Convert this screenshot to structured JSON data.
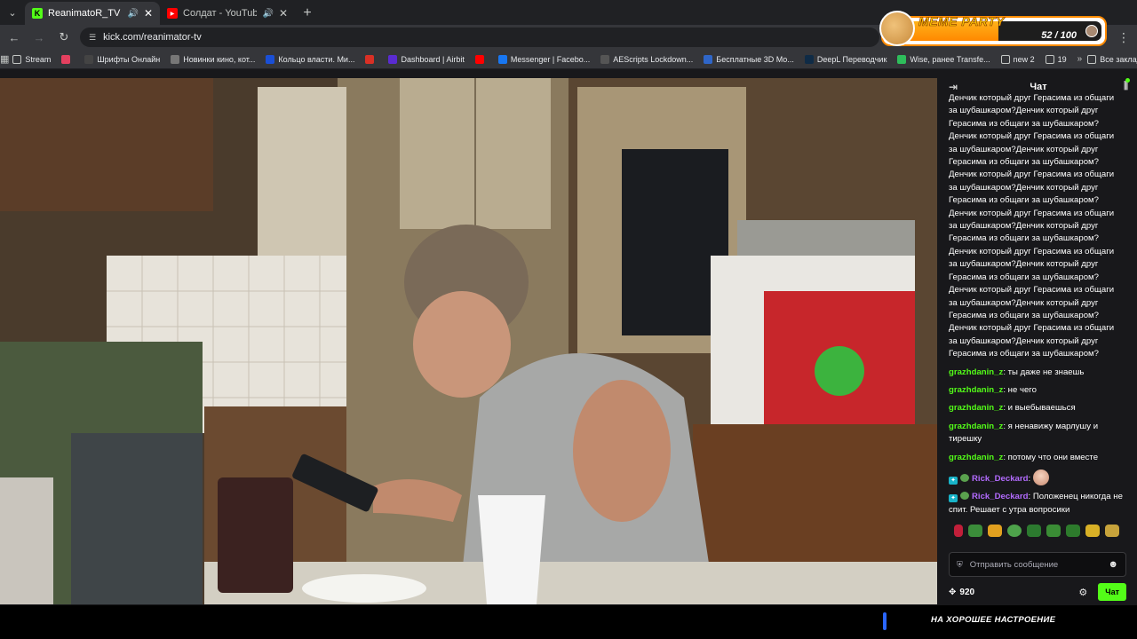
{
  "browser": {
    "tabs": [
      {
        "title": "ReanimatoR_TV Stream - K",
        "active": true,
        "favicon": "kick-icon",
        "icon_color": "#53fc18",
        "icon_char": "K"
      },
      {
        "title": "Солдат - YouTube",
        "active": false,
        "favicon": "youtube-icon",
        "icon_color": "#ff0000",
        "icon_char": "▶"
      }
    ],
    "url": "kick.com/reanimator-tv",
    "bookmarks": [
      {
        "label": "Stream",
        "icon": "folder-icon"
      },
      {
        "label": "",
        "icon": "bookmark-red-icon"
      },
      {
        "label": "Шрифты Онлайн",
        "icon": "font-icon"
      },
      {
        "label": "Новинки кино, кот...",
        "icon": "cat-icon"
      },
      {
        "label": "Кольцо власти. Ми...",
        "icon": "play-icon"
      },
      {
        "label": "",
        "icon": "gmail-icon"
      },
      {
        "label": "Dashboard | Airbit",
        "icon": "airbit-icon"
      },
      {
        "label": "",
        "icon": "youtube-icon"
      },
      {
        "label": "Messenger | Facebo...",
        "icon": "facebook-icon"
      },
      {
        "label": "AEScripts Lockdown...",
        "icon": "aescripts-icon"
      },
      {
        "label": "Бесплатные 3D Мо...",
        "icon": "3d-icon"
      },
      {
        "label": "DeepL Переводчик",
        "icon": "deepl-icon"
      },
      {
        "label": "Wise, ранее Transfe...",
        "icon": "wise-icon"
      },
      {
        "label": "new 2",
        "icon": "folder-icon"
      },
      {
        "label": "19",
        "icon": "folder-icon"
      }
    ],
    "bookmarks_all": "Все закладки",
    "more_label": "»"
  },
  "meme_party": {
    "title": "MEME PARTY",
    "count": "52 / 100",
    "progress": 0.52
  },
  "chat": {
    "title": "Чат",
    "spam_lines": [
      "Денчик который друг Герасима из общаги",
      "за шубашкаром?Денчик который друг",
      "Герасима из общаги за шубашкаром?",
      "Денчик который друг Герасима из общаги",
      "за шубашкаром?Денчик который друг",
      "Герасима из общаги за шубашкаром?",
      "Денчик который друг Герасима из общаги",
      "за шубашкаром?Денчик который друг",
      "Герасима из общаги за шубашкаром?",
      "Денчик который друг Герасима из общаги",
      "за шубашкаром?Денчик который друг",
      "Герасима из общаги за шубашкаром?",
      "Денчик который друг Герасима из общаги",
      "за шубашкаром?Денчик который друг",
      "Герасима из общаги за шубашкаром?",
      "Денчик который друг Герасима из общаги",
      "за шубашкаром?Денчик который друг",
      "Герасима из общаги за шубашкаром?",
      "Денчик который друг Герасима из общаги",
      "за шубашкаром?Денчик который друг",
      "Герасима из общаги за шубашкаром?"
    ],
    "messages": [
      {
        "user": "grazhdanin_z",
        "text": "ты даже не знаешь",
        "color": "#53fc18"
      },
      {
        "user": "grazhdanin_z",
        "text": "не чего",
        "color": "#53fc18"
      },
      {
        "user": "grazhdanin_z",
        "text": "и выебываешься",
        "color": "#53fc18"
      },
      {
        "user": "grazhdanin_z",
        "text": "я ненавижу марлушу и тирешку",
        "color": "#53fc18"
      },
      {
        "user": "grazhdanin_z",
        "text": "потому что они вместе",
        "color": "#53fc18"
      },
      {
        "user": "Rick_Deckard",
        "text": "",
        "color": "#b36bff"
      },
      {
        "user": "Rick_Deckard",
        "text": "Положенец никогда не спит. Решает с утра вопросики",
        "color": "#b36bff"
      }
    ],
    "input_placeholder": "Отправить сообщение",
    "points": "920",
    "send_label": "Чат"
  },
  "overlay": {
    "caption": "НА ХОРОШЕЕ НАСТРОЕНИЕ"
  },
  "colors": {
    "kick_green": "#53fc18",
    "meme_orange": "#ff8a00"
  }
}
